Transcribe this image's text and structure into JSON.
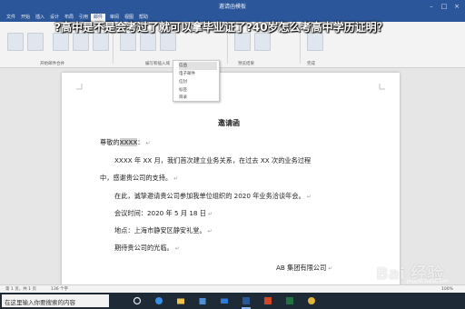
{
  "window": {
    "title": "邀请函模板"
  },
  "overlay": {
    "headline": "?高中是不是会考过了就可以拿毕业证了?40岁怎么考高中学历证明？"
  },
  "tabs": [
    "文件",
    "开始",
    "插入",
    "设计",
    "布局",
    "引用",
    "邮件",
    "审阅",
    "视图",
    "帮助"
  ],
  "ribbon": {
    "groups": [
      "开始邮件合并",
      "编写和插入域",
      "预览结果",
      "完成"
    ]
  },
  "dropdown": {
    "items": [
      "信函",
      "电子邮件",
      "信封",
      "标签",
      "目录"
    ]
  },
  "document": {
    "title": "邀请函",
    "greeting_prefix": "尊敬的",
    "greeting_name": "XXXX",
    "greeting_suffix": "：",
    "para1_line1": "XXXX 年 XX 月，我们首次建立业务关系，在过去 XX 次的业务过程",
    "para1_line2": "中，感谢贵公司的支持。",
    "line_now": "在此，诚挚邀请贵公司参加我单位组织的 2020 年业务洽谈年会。",
    "line_time": "会议时间：2020 年 5 月 18 日",
    "line_place": "地点：上海市静安区静安礼堂。",
    "line_expect": "期待贵公司的光临。",
    "signature": "AB 集团有限公司",
    "paragraph_mark": "↵"
  },
  "statusbar": {
    "page": "第 1 页，共 1 页",
    "words": "136 个字",
    "zoom": "100%"
  },
  "taskbar": {
    "search_placeholder": "在这里输入你要搜索的内容"
  },
  "watermark": {
    "brand": "Bai 经验",
    "sub": "jingyan.baidu.com"
  },
  "colors": {
    "accent": "#2b579a",
    "taskbar": "#1f2a37"
  },
  "icons": [
    "search-icon",
    "task-view-icon",
    "edge-icon",
    "folder-icon",
    "store-icon",
    "mail-icon",
    "word-icon",
    "powerpoint-icon",
    "excel-icon",
    "chrome-icon",
    "windows-icon"
  ]
}
